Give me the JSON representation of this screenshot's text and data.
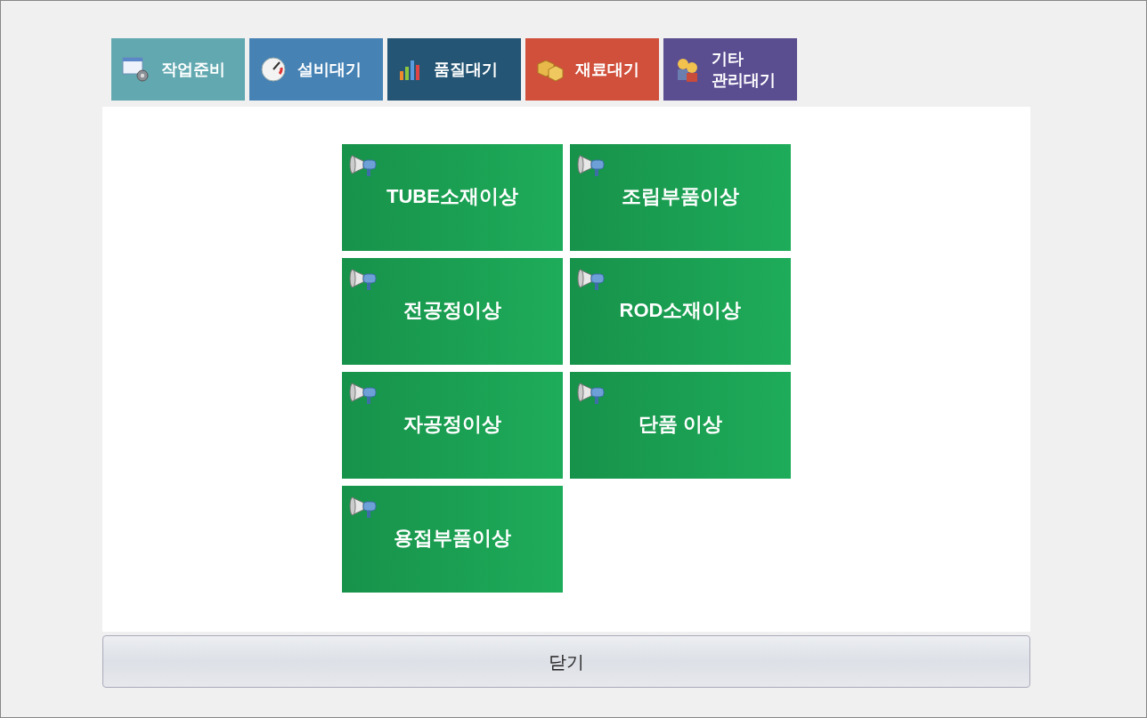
{
  "tabs": [
    {
      "label": "작업준비",
      "kind": "setup",
      "color": "#61a8b0"
    },
    {
      "label": "설비대기",
      "kind": "gauge",
      "color": "#4682b4"
    },
    {
      "label": "품질대기",
      "kind": "chart",
      "color": "#245574"
    },
    {
      "label": "재료대기",
      "kind": "boxes",
      "color": "#d0503c"
    },
    {
      "label": "기타\n관리대기",
      "kind": "workers",
      "color": "#5a4d90"
    }
  ],
  "alerts": [
    "TUBE소재이상",
    "조립부품이상",
    "전공정이상",
    "ROD소재이상",
    "자공정이상",
    "단품 이상",
    "용접부품이상"
  ],
  "close_button": "닫기"
}
